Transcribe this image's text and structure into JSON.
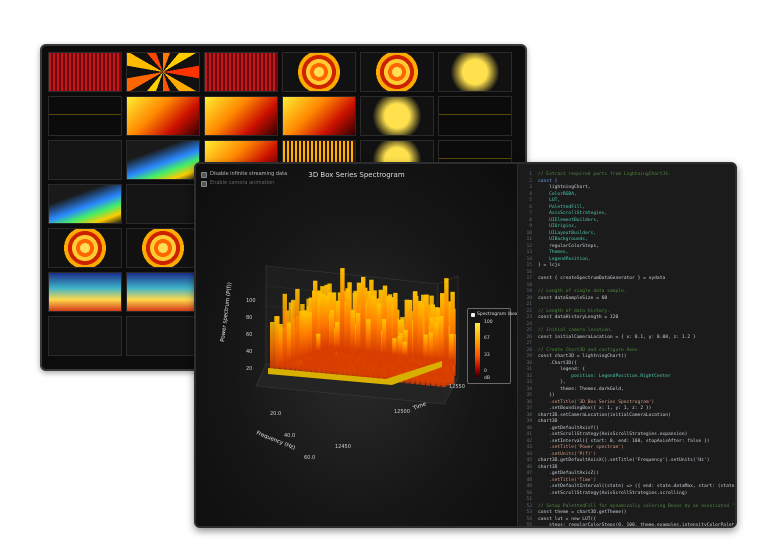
{
  "gallery": {
    "thumbnails": [
      {
        "icon": "red-waveform-icon",
        "style": "t-red"
      },
      {
        "icon": "fan-chart-icon",
        "style": "t-fan"
      },
      {
        "icon": "red-waveform-icon",
        "style": "t-red"
      },
      {
        "icon": "concentric-rings-icon",
        "style": "t-rings"
      },
      {
        "icon": "concentric-rings-icon",
        "style": "t-rings"
      },
      {
        "icon": "point-cloud-icon",
        "style": "t-dots"
      },
      {
        "icon": "line-chart-icon",
        "style": "t-line"
      },
      {
        "icon": "3d-surface-icon",
        "style": "t-heat"
      },
      {
        "icon": "3d-heart-surface-icon",
        "style": "t-heat"
      },
      {
        "icon": "3d-box-chart-icon",
        "style": "t-heat"
      },
      {
        "icon": "point-cloud-icon",
        "style": "t-dots"
      },
      {
        "icon": "line-chart-icon",
        "style": "t-line"
      },
      {
        "icon": "3d-boxes-white-icon",
        "style": "t-gray"
      },
      {
        "icon": "3d-surface-blue-icon",
        "style": "t-blue"
      },
      {
        "icon": "spectrogram-peaks-icon",
        "style": "t-heat"
      },
      {
        "icon": "bar-chart-icon",
        "style": "t-bars"
      },
      {
        "icon": "point-cloud-icon",
        "style": "t-dots"
      },
      {
        "icon": "line-chart-icon",
        "style": "t-line"
      },
      {
        "icon": "3d-terrain-icon",
        "style": "t-blue"
      },
      {
        "icon": "3d-scatter-icon",
        "style": "t-gray"
      },
      {
        "icon": "empty-thumb",
        "style": "t-gray"
      },
      {
        "icon": "empty-thumb",
        "style": "t-gray"
      },
      {
        "icon": "empty-thumb",
        "style": "t-gray"
      },
      {
        "icon": "empty-thumb",
        "style": "t-gray"
      },
      {
        "icon": "radial-heatmap-icon",
        "style": "t-rings"
      },
      {
        "icon": "radial-heatmap-icon",
        "style": "t-rings"
      },
      {
        "icon": "empty-thumb",
        "style": "t-gray"
      },
      {
        "icon": "empty-thumb",
        "style": "t-gray"
      },
      {
        "icon": "empty-thumb",
        "style": "t-gray"
      },
      {
        "icon": "empty-thumb",
        "style": "t-gray"
      },
      {
        "icon": "heatmap-icon",
        "style": "t-map"
      },
      {
        "icon": "world-map-icon",
        "style": "t-map"
      },
      {
        "icon": "empty-thumb",
        "style": "t-gray"
      },
      {
        "icon": "empty-thumb",
        "style": "t-gray"
      },
      {
        "icon": "empty-thumb",
        "style": "t-gray"
      },
      {
        "icon": "empty-thumb",
        "style": "t-gray"
      },
      {
        "icon": "3d-ribbon-icon",
        "style": "t-gray"
      },
      {
        "icon": "empty-thumb",
        "style": "t-gray"
      },
      {
        "icon": "empty-thumb",
        "style": "t-gray"
      },
      {
        "icon": "empty-thumb",
        "style": "t-gray"
      },
      {
        "icon": "empty-thumb",
        "style": "t-gray"
      },
      {
        "icon": "empty-thumb",
        "style": "t-gray"
      }
    ]
  },
  "controls": {
    "streaming": "Disable infinite streaming data",
    "camera": "Enable camera animation"
  },
  "chart": {
    "title": "3D Box Series Spectrogram",
    "y_label": "Power spectrum (P(f))",
    "x_label": "Frequency (Hz)",
    "z_label": "Time",
    "legend_title": "Spectrogram (box)"
  },
  "chart_data": {
    "type": "heatmap",
    "title": "3D Box Series Spectrogram",
    "ylabel": "Power spectrum (P(f))",
    "xlabel": "Frequency (Hz)",
    "zlabel": "Time",
    "y_ticks": [
      "100",
      "80",
      "60",
      "40",
      "20"
    ],
    "x_ticks": [
      "20.0",
      "40.0",
      "60.0"
    ],
    "z_ticks": [
      "12450",
      "12500",
      "12550"
    ],
    "ylim": [
      0,
      100
    ],
    "legend": {
      "title": "Spectrogram (box)",
      "ticks": [
        "100",
        "67",
        "33",
        "0",
        "dB"
      ]
    }
  },
  "code": [
    {
      "n": "1",
      "t": "// Extract required parts from LightningChartJS.",
      "c": "cm"
    },
    {
      "n": "2",
      "t": "const {",
      "c": "kw"
    },
    {
      "n": "3",
      "t": "    lightningChart,",
      "c": "mt"
    },
    {
      "n": "4",
      "t": "    ColorRGBA,",
      "c": "pr"
    },
    {
      "n": "5",
      "t": "    LUT,",
      "c": "pr"
    },
    {
      "n": "6",
      "t": "    PalettedFill,",
      "c": "pr"
    },
    {
      "n": "7",
      "t": "    AxisScrollStrategies,",
      "c": "pr"
    },
    {
      "n": "8",
      "t": "    UIElementBuilders,",
      "c": "pr"
    },
    {
      "n": "9",
      "t": "    UIOrigins,",
      "c": "pr"
    },
    {
      "n": "10",
      "t": "    UILayoutBuilders,",
      "c": "pr"
    },
    {
      "n": "11",
      "t": "    UIBackgrounds,",
      "c": "pr"
    },
    {
      "n": "12",
      "t": "    regularColorSteps,",
      "c": "mt"
    },
    {
      "n": "13",
      "t": "    Themes,",
      "c": "pr"
    },
    {
      "n": "14",
      "t": "    LegendPosition,",
      "c": "pr"
    },
    {
      "n": "15",
      "t": "} = lcjs",
      "c": "mt"
    },
    {
      "n": "16",
      "t": "",
      "c": "mt"
    },
    {
      "n": "17",
      "t": "const { createSpectrumDataGenerator } = xydata",
      "c": "mt"
    },
    {
      "n": "18",
      "t": "",
      "c": "mt"
    },
    {
      "n": "19",
      "t": "// Length of single data sample.",
      "c": "cm"
    },
    {
      "n": "20",
      "t": "const dataSampleSize = 60",
      "c": "mt"
    },
    {
      "n": "21",
      "t": "",
      "c": "mt"
    },
    {
      "n": "22",
      "t": "// Length of data history.",
      "c": "cm"
    },
    {
      "n": "23",
      "t": "const dataHistoryLength = 120",
      "c": "mt"
    },
    {
      "n": "24",
      "t": "",
      "c": "mt"
    },
    {
      "n": "25",
      "t": "// Initial camera location.",
      "c": "cm"
    },
    {
      "n": "26",
      "t": "const initialCameraLocation = { x: 0.1, y: 0.08, z: 1.2 }",
      "c": "mt"
    },
    {
      "n": "27",
      "t": "",
      "c": "mt"
    },
    {
      "n": "28",
      "t": "// Create Chart3D and configure Axes.",
      "c": "cm"
    },
    {
      "n": "29",
      "t": "const chart3D = lightningChart()",
      "c": "mt"
    },
    {
      "n": "30",
      "t": "    .Chart3D({",
      "c": "mt"
    },
    {
      "n": "31",
      "t": "        legend: {",
      "c": "mt"
    },
    {
      "n": "32",
      "t": "            position: LegendPosition.RightCenter",
      "c": "pr"
    },
    {
      "n": "33",
      "t": "        },",
      "c": "mt"
    },
    {
      "n": "34",
      "t": "        theme: Themes.darkGold,",
      "c": "mt"
    },
    {
      "n": "35",
      "t": "    })",
      "c": "mt"
    },
    {
      "n": "36",
      "t": "    .setTitle('3D Box Series Spectrogram')",
      "c": "st"
    },
    {
      "n": "37",
      "t": "    .setBoundingBox({ x: 1, y: 1, z: 2 })",
      "c": "mt"
    },
    {
      "n": "38",
      "t": "chart3D.setCameraLocation(initialCameraLocation)",
      "c": "mt"
    },
    {
      "n": "39",
      "t": "chart3D",
      "c": "mt"
    },
    {
      "n": "40",
      "t": "    .getDefaultAxisY()",
      "c": "mt"
    },
    {
      "n": "41",
      "t": "    .setScrollStrategy(AxisScrollStrategies.expansion)",
      "c": "mt"
    },
    {
      "n": "42",
      "t": "    .setInterval({ start: 0, end: 100, stopAxisAfter: false })",
      "c": "mt"
    },
    {
      "n": "43",
      "t": "    .setTitle('Power spectrum')",
      "c": "st"
    },
    {
      "n": "44",
      "t": "    .setUnits('P(f)')",
      "c": "st"
    },
    {
      "n": "45",
      "t": "chart3D.getDefaultAxisX().setTitle('Frequency').setUnits('Hz')",
      "c": "mt"
    },
    {
      "n": "46",
      "t": "chart3D",
      "c": "mt"
    },
    {
      "n": "47",
      "t": "    .getDefaultAxisZ()",
      "c": "mt"
    },
    {
      "n": "48",
      "t": "    .setTitle('Time')",
      "c": "st"
    },
    {
      "n": "49",
      "t": "    .setDefaultInterval((state) => ({ end: state.dataMax, start: (state.datal",
      "c": "mt"
    },
    {
      "n": "50",
      "t": "    .setScrollStrategy(AxisScrollStrategies.scrolling)",
      "c": "mt"
    },
    {
      "n": "51",
      "t": "",
      "c": "mt"
    },
    {
      "n": "52",
      "t": "// Setup PalettedFill for dynamically coloring Boxes by an associated 'value",
      "c": "cm"
    },
    {
      "n": "53",
      "t": "const theme = chart3D.getTheme()",
      "c": "mt"
    },
    {
      "n": "54",
      "t": "const lut = new LUT({",
      "c": "mt"
    },
    {
      "n": "55",
      "t": "    steps: regularColorSteps(0, 100, theme.examples.intensityColorPalette),",
      "c": "mt"
    },
    {
      "n": "56",
      "t": "    interpolate: true,",
      "c": "mt"
    }
  ]
}
